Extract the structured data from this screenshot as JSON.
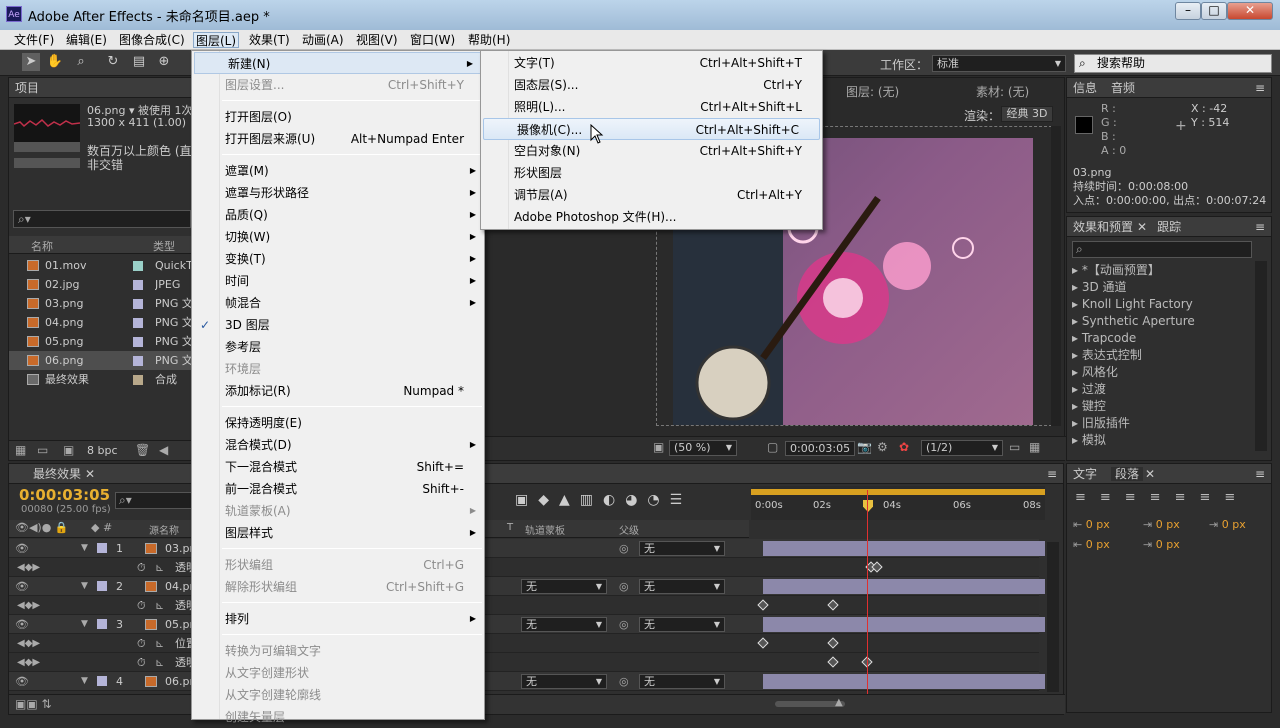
{
  "app": {
    "title": "Adobe After Effects - 未命名项目.aep *",
    "icon_text": "Ae"
  },
  "window_buttons": {
    "minimize": "–",
    "maximize": "□",
    "close": "✕"
  },
  "menubar": [
    "文件(F)",
    "编辑(E)",
    "图像合成(C)",
    "图层(L)",
    "效果(T)",
    "动画(A)",
    "视图(V)",
    "窗口(W)",
    "帮助(H)"
  ],
  "toolbar": {
    "workspace_label": "工作区：",
    "workspace_value": "标准",
    "search_placeholder": "搜索帮助"
  },
  "project": {
    "tab": "项目",
    "preview_name": "06.png",
    "preview_used": "▾ 被使用 1次",
    "preview_dims": "1300 x 411 (1.00)",
    "preview_info1": "数百万以上颜色 (直",
    "preview_info2": "非交错",
    "col_name": "名称",
    "col_type": "类型",
    "items": [
      {
        "name": "01.mov",
        "type": "QuickTi",
        "color": "#9ad0c8"
      },
      {
        "name": "02.jpg",
        "type": "JPEG",
        "color": "#b4b4d8"
      },
      {
        "name": "03.png",
        "type": "PNG 文",
        "color": "#b4b4d8"
      },
      {
        "name": "04.png",
        "type": "PNG 文",
        "color": "#b4b4d8"
      },
      {
        "name": "05.png",
        "type": "PNG 文",
        "color": "#b4b4d8"
      },
      {
        "name": "06.png",
        "type": "PNG 文",
        "color": "#b4b4d8"
      },
      {
        "name": "最终效果",
        "type": "合成",
        "color": "#b8a88a"
      }
    ],
    "bpc": "8 bpc"
  },
  "layer_menu": [
    {
      "label": "新建(N)",
      "shortcut": "",
      "arrow": true,
      "disabled": false
    },
    {
      "label": "图层设置...",
      "shortcut": "Ctrl+Shift+Y",
      "arrow": false,
      "disabled": true
    },
    {
      "sep": true
    },
    {
      "label": "打开图层(O)",
      "shortcut": "",
      "arrow": false,
      "disabled": false
    },
    {
      "label": "打开图层来源(U)",
      "shortcut": "Alt+Numpad Enter",
      "arrow": false,
      "disabled": false
    },
    {
      "sep": true
    },
    {
      "label": "遮罩(M)",
      "shortcut": "",
      "arrow": true,
      "disabled": false
    },
    {
      "label": "遮罩与形状路径",
      "shortcut": "",
      "arrow": true,
      "disabled": false
    },
    {
      "label": "品质(Q)",
      "shortcut": "",
      "arrow": true,
      "disabled": false
    },
    {
      "label": "切换(W)",
      "shortcut": "",
      "arrow": true,
      "disabled": false
    },
    {
      "label": "变换(T)",
      "shortcut": "",
      "arrow": true,
      "disabled": false
    },
    {
      "label": "时间",
      "shortcut": "",
      "arrow": true,
      "disabled": false
    },
    {
      "label": "帧混合",
      "shortcut": "",
      "arrow": true,
      "disabled": false
    },
    {
      "label": "3D 图层",
      "shortcut": "",
      "arrow": false,
      "disabled": false,
      "checked": true
    },
    {
      "label": "参考层",
      "shortcut": "",
      "arrow": false,
      "disabled": false
    },
    {
      "label": "环境层",
      "shortcut": "",
      "arrow": false,
      "disabled": true
    },
    {
      "label": "添加标记(R)",
      "shortcut": "Numpad *",
      "arrow": false,
      "disabled": false
    },
    {
      "sep": true
    },
    {
      "label": "保持透明度(E)",
      "shortcut": "",
      "arrow": false,
      "disabled": false
    },
    {
      "label": "混合模式(D)",
      "shortcut": "",
      "arrow": true,
      "disabled": false
    },
    {
      "label": "下一混合模式",
      "shortcut": "Shift+=",
      "arrow": false,
      "disabled": false
    },
    {
      "label": "前一混合模式",
      "shortcut": "Shift+-",
      "arrow": false,
      "disabled": false
    },
    {
      "label": "轨道蒙板(A)",
      "shortcut": "",
      "arrow": true,
      "disabled": true
    },
    {
      "label": "图层样式",
      "shortcut": "",
      "arrow": true,
      "disabled": false
    },
    {
      "sep": true
    },
    {
      "label": "形状编组",
      "shortcut": "Ctrl+G",
      "arrow": false,
      "disabled": true
    },
    {
      "label": "解除形状编组",
      "shortcut": "Ctrl+Shift+G",
      "arrow": false,
      "disabled": true
    },
    {
      "sep": true
    },
    {
      "label": "排列",
      "shortcut": "",
      "arrow": true,
      "disabled": false
    },
    {
      "sep": true
    },
    {
      "label": "转换为可编辑文字",
      "shortcut": "",
      "arrow": false,
      "disabled": true
    },
    {
      "label": "从文字创建形状",
      "shortcut": "",
      "arrow": false,
      "disabled": true
    },
    {
      "label": "从文字创建轮廓线",
      "shortcut": "",
      "arrow": false,
      "disabled": true
    },
    {
      "label": "创建矢量层",
      "shortcut": "",
      "arrow": false,
      "disabled": true
    }
  ],
  "new_submenu": [
    {
      "label": "文字(T)",
      "shortcut": "Ctrl+Alt+Shift+T"
    },
    {
      "label": "固态层(S)...",
      "shortcut": "Ctrl+Y"
    },
    {
      "label": "照明(L)...",
      "shortcut": "Ctrl+Alt+Shift+L"
    },
    {
      "label": "摄像机(C)...",
      "shortcut": "Ctrl+Alt+Shift+C",
      "highlight": true
    },
    {
      "label": "空白对象(N)",
      "shortcut": "Ctrl+Alt+Shift+Y"
    },
    {
      "label": "形状图层",
      "shortcut": ""
    },
    {
      "label": "调节层(A)",
      "shortcut": "Ctrl+Alt+Y"
    },
    {
      "label": "Adobe Photoshop 文件(H)...",
      "shortcut": ""
    }
  ],
  "viewer": {
    "layer_tab": "图层: (无)",
    "material_tab": "素材: (无)",
    "render_label": "渲染：",
    "render_value": "经典 3D",
    "zoom": "(50 %)",
    "timecode": "0:00:03:05",
    "resolution": "(1/2)"
  },
  "info": {
    "tab_info": "信息",
    "tab_audio": "音频",
    "r": "R :",
    "g": "G :",
    "b": "B :",
    "a": "A : 0",
    "x": "X : -42",
    "y": "Y : 514",
    "file": "03.png",
    "duration": "持续时间：0:00:08:00",
    "inout": "入点：0:00:00:00, 出点：0:00:07:24"
  },
  "effects": {
    "tab": "效果和预置",
    "tab2": "跟踪",
    "items": [
      "*【动画预置】",
      "3D 通道",
      "Knoll Light Factory",
      "Synthetic Aperture",
      "Trapcode",
      "表达式控制",
      "风格化",
      "过渡",
      "键控",
      "旧版插件",
      "模拟"
    ]
  },
  "char_panel": {
    "tab_text": "文字",
    "tab_para": "段落",
    "px1": "0 px",
    "px2": "0 px",
    "px3": "0 px",
    "px4": "0 px",
    "px5": "0 px"
  },
  "timeline": {
    "tab": "最终效果",
    "timecode": "0:00:03:05",
    "fps": "00080 (25.00 fps)",
    "col_name": "源名称",
    "col_trkmat": "轨道蒙板",
    "col_parent": "父级",
    "col_t": "T",
    "ruler": [
      "0:00s",
      "02s",
      "04s",
      "06s",
      "08s"
    ],
    "none": "无",
    "rows": [
      {
        "num": "1",
        "name": "03.pn",
        "kind": "layer"
      },
      {
        "name": "透明",
        "kind": "prop"
      },
      {
        "num": "2",
        "name": "04.pn",
        "kind": "layer"
      },
      {
        "name": "透明",
        "kind": "prop"
      },
      {
        "num": "3",
        "name": "05.pn",
        "kind": "layer"
      },
      {
        "name": "位置",
        "kind": "prop"
      },
      {
        "name": "透明",
        "kind": "prop"
      },
      {
        "num": "4",
        "name": "06.pn",
        "kind": "layer"
      }
    ]
  }
}
